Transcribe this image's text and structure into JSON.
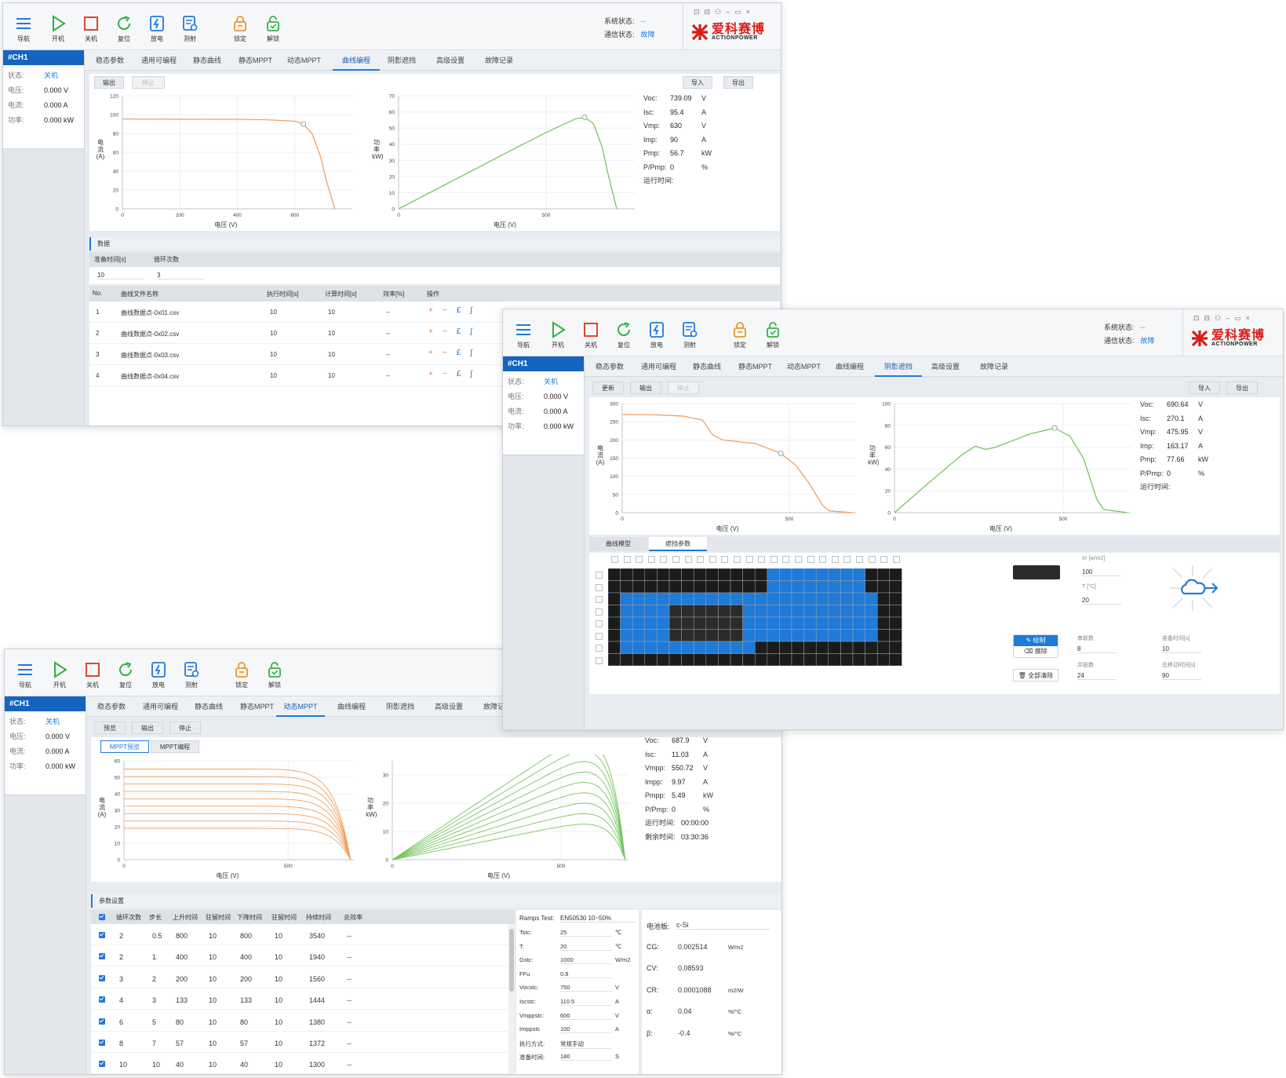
{
  "toolbar": {
    "nav": "导航",
    "on": "开机",
    "off": "关机",
    "reset": "复位",
    "discharge": "放电",
    "record": "测射",
    "lock": "锁定",
    "unlock": "解锁"
  },
  "status": {
    "sys_label": "系统状态:",
    "sys_value": "--",
    "comm_label": "通信状态:",
    "comm_value": "故障"
  },
  "logo": {
    "cn": "爱科赛博",
    "en": "ACTIONPOWER"
  },
  "channel": {
    "name": "#CH1",
    "state_label": "状态:",
    "state_value": "关机",
    "voltage_label": "电压:",
    "voltage_value": "0.000 V",
    "current_label": "电流:",
    "current_value": "0.000 A",
    "power_label": "功率:",
    "power_value": "0.000 kW"
  },
  "tabs": [
    "稳态参数",
    "通用可编程",
    "静态曲线",
    "静态MPPT",
    "动态MPPT",
    "曲线编程",
    "阴影遮挡",
    "高级设置",
    "故障记录"
  ],
  "labels": {
    "current_axis": "电流(A)",
    "power_axis": "功率(kW)",
    "voltage_axis": "电压 (V)",
    "runtime": "运行时间:",
    "remaining": "剩余时间:"
  },
  "win1": {
    "btn_output": "输出",
    "btn_stop": "停止",
    "btn_import": "导入",
    "btn_export": "导出",
    "params": [
      {
        "k": "Voc:",
        "v": "739.09",
        "u": "V"
      },
      {
        "k": "Isc:",
        "v": "95.4",
        "u": "A"
      },
      {
        "k": "Vmp:",
        "v": "630",
        "u": "V"
      },
      {
        "k": "Imp:",
        "v": "90",
        "u": "A"
      },
      {
        "k": "Pmp:",
        "v": "56.7",
        "u": "kW"
      },
      {
        "k": "P/Pmp:",
        "v": "0",
        "u": "%"
      }
    ],
    "section": "数据",
    "prep_label": "准备时间[s]",
    "cycle_label": "循环次数",
    "prep_value": "10",
    "cycle_value": "3",
    "headers": [
      "No.",
      "曲线文件名称",
      "执行时间[s]",
      "计算时间[s]",
      "效率[%]",
      "操作"
    ],
    "rows": [
      [
        "1",
        "曲线数据点-0x01.csv",
        "10",
        "10",
        "--"
      ],
      [
        "2",
        "曲线数据点-0x02.csv",
        "10",
        "10",
        "--"
      ],
      [
        "3",
        "曲线数据点-0x03.csv",
        "10",
        "10",
        "--"
      ],
      [
        "4",
        "曲线数据点-0x04.csv",
        "10",
        "10",
        "--"
      ]
    ]
  },
  "win2": {
    "btn_update": "更新",
    "btn_output": "输出",
    "btn_stop": "停止",
    "btn_import": "导入",
    "btn_export": "导出",
    "params": [
      {
        "k": "Voc:",
        "v": "690.64",
        "u": "V"
      },
      {
        "k": "Isc:",
        "v": "270.1",
        "u": "A"
      },
      {
        "k": "Vmp:",
        "v": "475.95",
        "u": "V"
      },
      {
        "k": "Imp:",
        "v": "163.17",
        "u": "A"
      },
      {
        "k": "Pmp:",
        "v": "77.66",
        "u": "kW"
      },
      {
        "k": "P/Pmp:",
        "v": "0",
        "u": "%"
      }
    ],
    "subtab_model": "曲线模型",
    "subtab_shade": "遮挡参数",
    "irr_label": "Irr [w/m2]",
    "irr_value": "100",
    "t_label": "T [°C]",
    "t_value": "20",
    "draw": "绘制",
    "erase": "擦除",
    "clear_all": "全部清除",
    "rows_label": "串联数",
    "rows_value": "8",
    "cols_label": "并联数",
    "cols_value": "24",
    "prep_label": "准备时间[s]",
    "prep_value": "10",
    "move_label": "总移动时间[s]",
    "move_value": "90"
  },
  "win3": {
    "btn_preview": "预览",
    "btn_output": "输出",
    "btn_stop": "停止",
    "sub_preview": "MPPT预览",
    "sub_program": "MPPT编程",
    "params": [
      {
        "k": "Voc:",
        "v": "687.9",
        "u": "V"
      },
      {
        "k": "Isc:",
        "v": "11.03",
        "u": "A"
      },
      {
        "k": "Vmpp:",
        "v": "550.72",
        "u": "V"
      },
      {
        "k": "Impp:",
        "v": "9.97",
        "u": "A"
      },
      {
        "k": "Pmpp:",
        "v": "5.49",
        "u": "kW"
      },
      {
        "k": "P/Pmp:",
        "v": "0",
        "u": "%"
      }
    ],
    "runtime_value": "00:00:00",
    "remaining_value": "03:30:36",
    "section": "参数设置",
    "headers": [
      "循环次数",
      "步长",
      "上升时间",
      "驻留时间",
      "下降时间",
      "驻留时间",
      "持续时间",
      "总效率"
    ],
    "rows": [
      [
        "2",
        "0.5",
        "800",
        "10",
        "800",
        "10",
        "3540",
        "--"
      ],
      [
        "2",
        "1",
        "400",
        "10",
        "400",
        "10",
        "1940",
        "--"
      ],
      [
        "3",
        "2",
        "200",
        "10",
        "200",
        "10",
        "1560",
        "--"
      ],
      [
        "4",
        "3",
        "133",
        "10",
        "133",
        "10",
        "1444",
        "--"
      ],
      [
        "6",
        "5",
        "80",
        "10",
        "80",
        "10",
        "1380",
        "--"
      ],
      [
        "8",
        "7",
        "57",
        "10",
        "57",
        "10",
        "1372",
        "--"
      ],
      [
        "10",
        "10",
        "40",
        "10",
        "40",
        "10",
        "1300",
        "--"
      ]
    ],
    "ramps_label": "Ramps Test:",
    "ramps_value": "EN50530 10~50%",
    "env": [
      {
        "k": "Tstc:",
        "v": "25",
        "u": "℃"
      },
      {
        "k": "T:",
        "v": "20",
        "u": "℃"
      },
      {
        "k": "Gstc:",
        "v": "1000",
        "u": "W/m2"
      },
      {
        "k": "FFu",
        "v": "0.8",
        "u": ""
      },
      {
        "k": "Vocstc:",
        "v": "750",
        "u": "V"
      },
      {
        "k": "Iscstc:",
        "v": "110.5",
        "u": "A"
      },
      {
        "k": "Vmppstc:",
        "v": "600",
        "u": "V"
      },
      {
        "k": "Imppstc",
        "v": "100",
        "u": "A"
      },
      {
        "k": "执行方式:",
        "v": "常规手动",
        "u": ""
      },
      {
        "k": "准备时间:",
        "v": "180",
        "u": "S"
      }
    ],
    "cell_label": "电池板:",
    "cell_value": "c-Si",
    "coef": [
      {
        "k": "CG:",
        "v": "0.002514",
        "u": "W/m2"
      },
      {
        "k": "CV:",
        "v": "0.08593",
        "u": ""
      },
      {
        "k": "CR:",
        "v": "0.0001088",
        "u": "m2/W"
      },
      {
        "k": "α:",
        "v": "0.04",
        "u": "%/°C"
      },
      {
        "k": "β:",
        "v": "-0.4",
        "u": "%/°C"
      }
    ]
  },
  "chart_data": [
    {
      "type": "line",
      "name": "win1-iv",
      "xlabel": "电压 (V)",
      "ylabel": "电流(A)",
      "xlim": [
        0,
        800
      ],
      "ylim": [
        0,
        120
      ],
      "x_ticks": [
        0,
        200,
        400,
        600
      ],
      "y_ticks": [
        0,
        20,
        40,
        60,
        80,
        100,
        120
      ],
      "x": [
        0,
        100,
        200,
        300,
        400,
        500,
        600,
        630,
        660,
        690,
        710,
        739
      ],
      "y": [
        95.4,
        95.3,
        95.2,
        95.1,
        95.0,
        94.6,
        93,
        90,
        80,
        55,
        30,
        0
      ],
      "mpp": [
        630,
        90
      ]
    },
    {
      "type": "line",
      "name": "win1-pv",
      "xlabel": "电压 (V)",
      "ylabel": "功率(kW)",
      "xlim": [
        0,
        800
      ],
      "ylim": [
        0,
        70
      ],
      "x_ticks": [
        0,
        500
      ],
      "y_ticks": [
        0,
        10,
        20,
        30,
        40,
        50,
        60,
        70
      ],
      "x": [
        0,
        100,
        200,
        300,
        400,
        500,
        600,
        630,
        660,
        690,
        710,
        739
      ],
      "y": [
        0,
        9.5,
        19,
        28.5,
        38,
        47.3,
        55.8,
        56.7,
        52.8,
        38,
        21.3,
        0
      ],
      "mpp": [
        630,
        56.7
      ]
    },
    {
      "type": "line",
      "name": "win2-iv",
      "xlabel": "电压 (V)",
      "ylabel": "电流(A)",
      "xlim": [
        0,
        700
      ],
      "ylim": [
        0,
        300
      ],
      "x_ticks": [
        0,
        500
      ],
      "y_ticks": [
        0,
        50,
        100,
        150,
        200,
        250,
        300
      ],
      "x": [
        0,
        100,
        180,
        240,
        270,
        300,
        400,
        475,
        520,
        560,
        600,
        620,
        690
      ],
      "y": [
        270,
        269,
        266,
        255,
        215,
        200,
        190,
        163,
        130,
        80,
        20,
        5,
        0
      ],
      "mpp": [
        475,
        163
      ]
    },
    {
      "type": "line",
      "name": "win2-pv",
      "xlabel": "电压 (V)",
      "ylabel": "功率(kW)",
      "xlim": [
        0,
        700
      ],
      "ylim": [
        0,
        100
      ],
      "x_ticks": [
        0,
        500
      ],
      "y_ticks": [
        0,
        20,
        40,
        60,
        80,
        100
      ],
      "x": [
        0,
        100,
        200,
        240,
        270,
        300,
        350,
        400,
        475,
        520,
        560,
        600,
        620,
        690
      ],
      "y": [
        0,
        27,
        53,
        61,
        58,
        60,
        66,
        72,
        77.66,
        70,
        50,
        12,
        3,
        0
      ],
      "mpp": [
        475,
        77.66
      ]
    },
    {
      "type": "line",
      "name": "win3-iv",
      "xlabel": "电压 (V)",
      "ylabel": "电流(A)",
      "xlim": [
        0,
        700
      ],
      "ylim": [
        0,
        60
      ],
      "x_ticks": [
        0,
        500
      ],
      "y_ticks": [
        0,
        10,
        20,
        30,
        40,
        50,
        60
      ],
      "series_isc": [
        55,
        50.5,
        46,
        41.5,
        37,
        32.5,
        28,
        23.5,
        19
      ]
    },
    {
      "type": "line",
      "name": "win3-pv",
      "xlabel": "电压 (V)",
      "ylabel": "功率(kW)",
      "xlim": [
        0,
        700
      ],
      "ylim": [
        0,
        35
      ],
      "x_ticks": [
        0,
        500
      ],
      "y_ticks": [
        0,
        10,
        20,
        30
      ],
      "series_pmax": [
        28.5,
        26,
        23.5,
        21,
        18.5,
        16,
        13.5,
        11,
        8.5
      ]
    }
  ]
}
